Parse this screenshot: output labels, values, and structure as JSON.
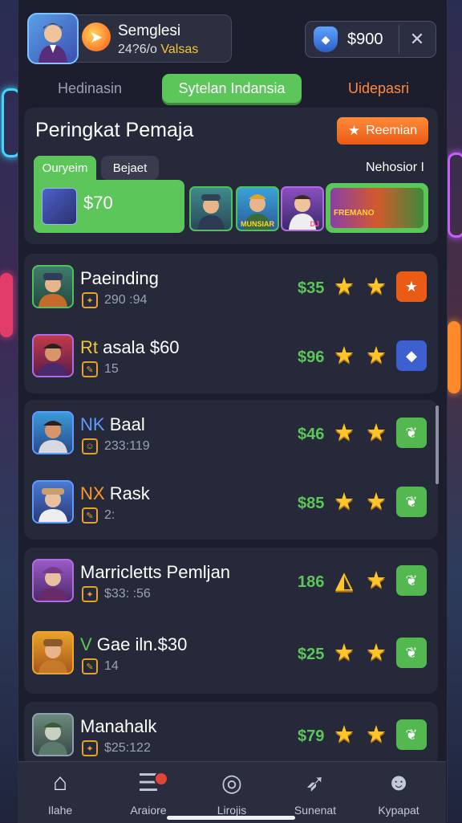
{
  "profile": {
    "name": "Semglesi",
    "sub_value": "24?6/o",
    "sub_accent": "Valsas"
  },
  "wallet": {
    "amount": "$900",
    "close_glyph": "✕"
  },
  "tabs": [
    {
      "label": "Hedinasin"
    },
    {
      "label": "Sytelan Indansia"
    },
    {
      "label": "Uidepasri"
    }
  ],
  "ranking": {
    "title": "Peringkat Pemaja",
    "premium_label": "Reemian",
    "subtabs": [
      "Ouryeim",
      "Bejaet"
    ],
    "right_label": "Nehosior I",
    "featured_amount": "$70",
    "mini_cards": [
      {
        "label": ""
      },
      {
        "label": "MUNSIAR"
      },
      {
        "label": "DJ"
      }
    ],
    "featured_card_label": "FREMANO"
  },
  "players": [
    {
      "name": "Paeinding",
      "prefix": "",
      "suffix": "",
      "meta": "290 :94",
      "price": "$35",
      "action": "star"
    },
    {
      "name": "asala $60",
      "prefix": "Rt ",
      "suffix": "",
      "meta": "15",
      "price": "$96",
      "action": "shield"
    },
    {
      "name": "Baal",
      "prefix": "NK ",
      "suffix": "",
      "meta": "233:119",
      "price": "$46",
      "action": "leaf"
    },
    {
      "name": "Rask",
      "prefix": "NX ",
      "suffix": "",
      "meta": "2:",
      "price": "$85",
      "action": "leaf"
    },
    {
      "name": "Marricletts Pemljan",
      "prefix": "",
      "suffix": "",
      "meta": "$33: :56",
      "price": "186",
      "action": "leaf"
    },
    {
      "name": "Gae iln.$30",
      "prefix": "V ",
      "suffix": "",
      "meta": "14",
      "price": "$25",
      "action": "leaf"
    },
    {
      "name": "Manahalk",
      "prefix": "",
      "suffix": "",
      "meta": "$25:122",
      "price": "$79",
      "action": "leaf"
    }
  ],
  "nav": [
    {
      "label": "Ilahe",
      "icon": "home-icon"
    },
    {
      "label": "Araiore",
      "icon": "news-icon"
    },
    {
      "label": "Lirojis",
      "icon": "target-icon"
    },
    {
      "label": "Sunenat",
      "icon": "rocket-icon"
    },
    {
      "label": "Kypapat",
      "icon": "person-icon"
    }
  ],
  "colors": {
    "accent_green": "#5dc65a",
    "accent_orange": "#ea5b15",
    "star_gold": "#ffc629",
    "panel_bg": "#1c1e2d",
    "card_bg": "#262939"
  }
}
